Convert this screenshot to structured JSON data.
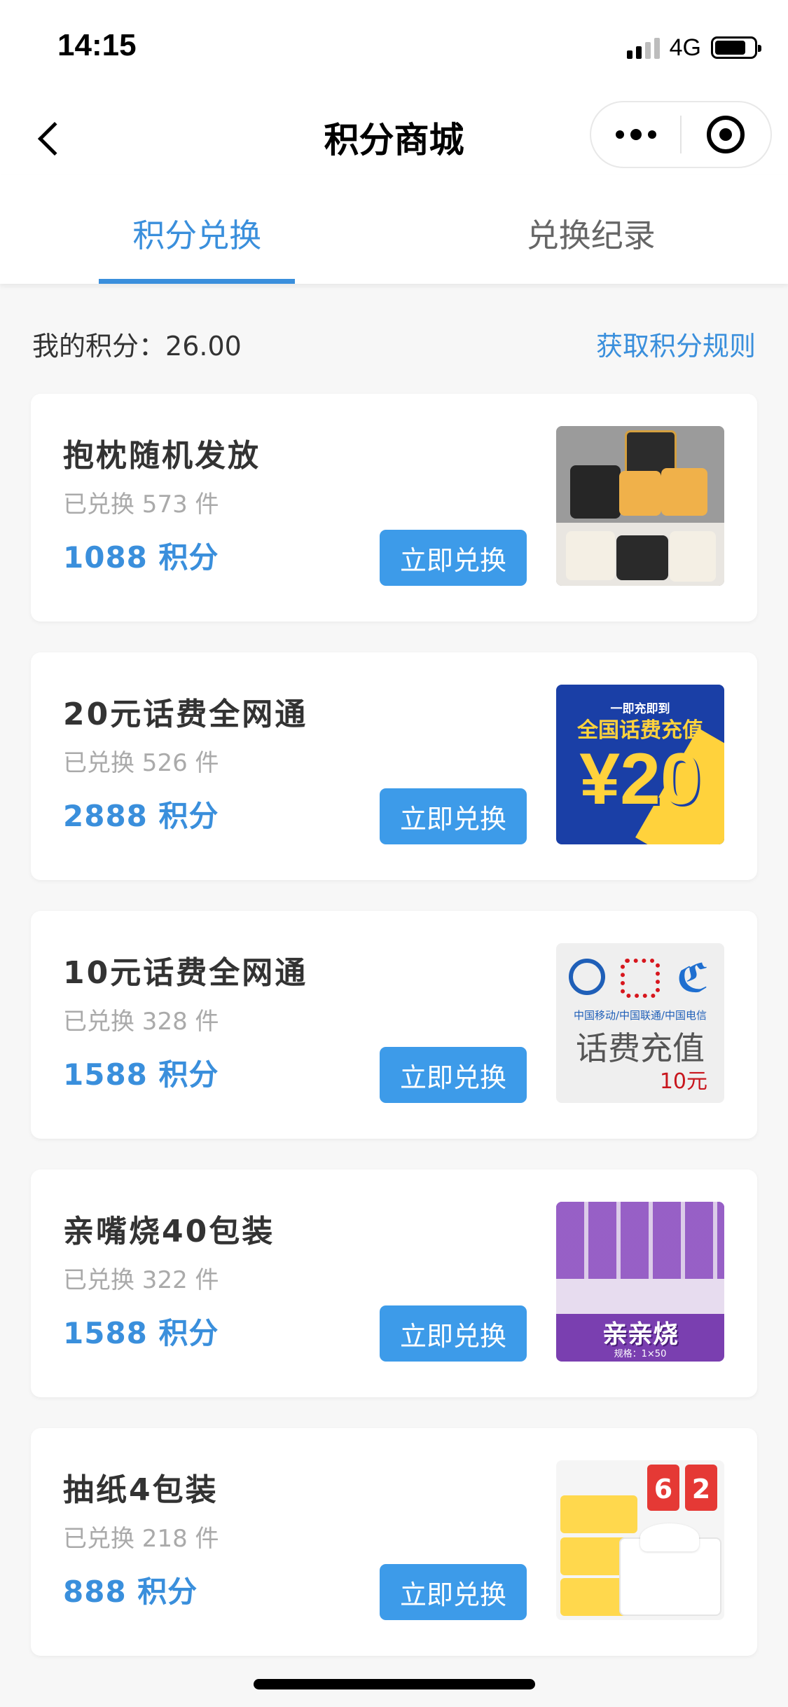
{
  "status_bar": {
    "time": "14:15",
    "network": "4G",
    "signal_icon": "signal-bars-icon",
    "battery_icon": "battery-icon",
    "battery_level": 0.8
  },
  "nav": {
    "title": "积分商城",
    "back_icon": "chevron-left-icon",
    "more_icon": "more-dots-icon",
    "close_icon": "target-circle-icon"
  },
  "tabs": [
    {
      "label": "积分兑换",
      "active": true
    },
    {
      "label": "兑换纪录",
      "active": false
    }
  ],
  "points": {
    "label": "我的积分：",
    "value": "26.00",
    "rules_link": "获取积分规则"
  },
  "accent_color": "#3a8fdc",
  "button_color": "#3d9be9",
  "products": [
    {
      "title": "抱枕随机发放",
      "sold": "已兑换 573 件",
      "price": "1088 积分",
      "button": "立即兑换",
      "image": "pillows-image"
    },
    {
      "title": "20元话费全网通",
      "sold": "已兑换 526 件",
      "price": "2888 积分",
      "button": "立即兑换",
      "image": "phone-credit-20-image",
      "image_text": {
        "top": "一即充即到",
        "middle": "全国话费充值",
        "amount": "¥20"
      }
    },
    {
      "title": "10元话费全网通",
      "sold": "已兑换 328 件",
      "price": "1588 积分",
      "button": "立即兑换",
      "image": "phone-credit-10-image",
      "image_text": {
        "carriers": "中国移动/中国联通/中国电信",
        "middle": "话费充值",
        "amount": "10元"
      }
    },
    {
      "title": "亲嘴烧40包装",
      "sold": "已兑换 322 件",
      "price": "1588 积分",
      "button": "立即兑换",
      "image": "snack-image",
      "image_text": {
        "brand": "亲亲烧",
        "spec": "规格：1×50"
      }
    },
    {
      "title": "抽纸4包装",
      "sold": "已兑换 218 件",
      "price": "888 积分",
      "button": "立即兑换",
      "image": "tissue-image",
      "image_text": {
        "promo1": "6",
        "promo2": "2"
      }
    }
  ]
}
